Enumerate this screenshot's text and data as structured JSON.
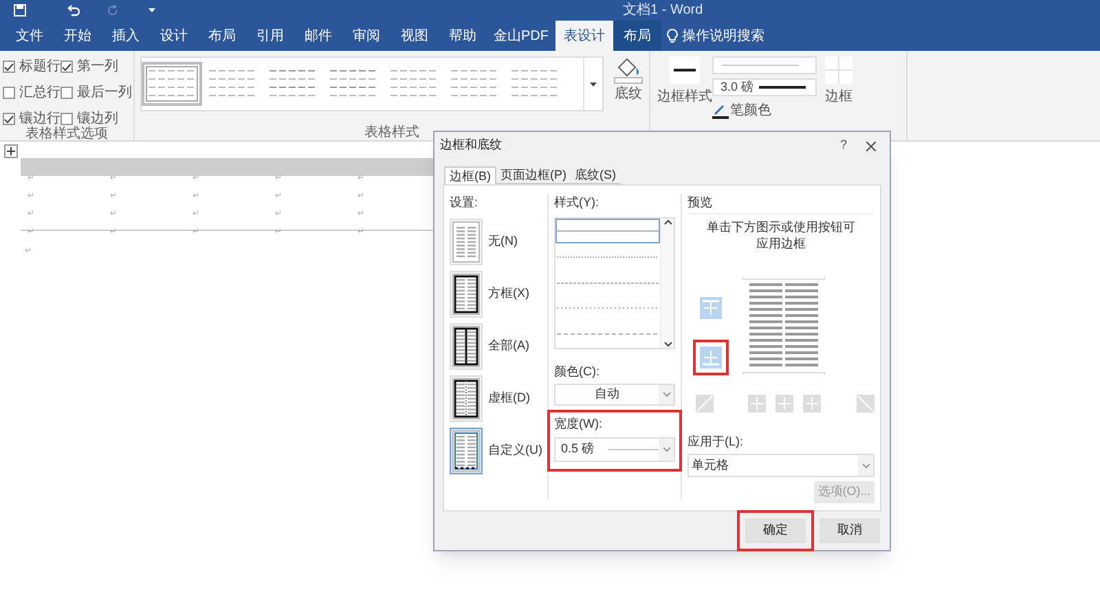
{
  "window": {
    "title": "文档1 - Word"
  },
  "ribbon_tabs": [
    {
      "label": "文件",
      "selected": false,
      "kind": "normal"
    },
    {
      "label": "开始",
      "selected": false,
      "kind": "normal"
    },
    {
      "label": "插入",
      "selected": false,
      "kind": "normal"
    },
    {
      "label": "设计",
      "selected": false,
      "kind": "normal"
    },
    {
      "label": "布局",
      "selected": false,
      "kind": "normal"
    },
    {
      "label": "引用",
      "selected": false,
      "kind": "normal"
    },
    {
      "label": "邮件",
      "selected": false,
      "kind": "normal"
    },
    {
      "label": "审阅",
      "selected": false,
      "kind": "normal"
    },
    {
      "label": "视图",
      "selected": false,
      "kind": "normal"
    },
    {
      "label": "帮助",
      "selected": false,
      "kind": "normal"
    },
    {
      "label": "金山PDF",
      "selected": false,
      "kind": "normal"
    },
    {
      "label": "表设计",
      "selected": true,
      "kind": "contextual"
    },
    {
      "label": "布局",
      "selected": false,
      "kind": "contextual"
    }
  ],
  "search": {
    "label": "操作说明搜索"
  },
  "table_style_options": {
    "group_label": "表格样式选项",
    "items": [
      {
        "label": "标题行",
        "checked": true
      },
      {
        "label": "第一列",
        "checked": true
      },
      {
        "label": "汇总行",
        "checked": false
      },
      {
        "label": "最后一列",
        "checked": false
      },
      {
        "label": "镶边行",
        "checked": true
      },
      {
        "label": "镶边列",
        "checked": false
      }
    ]
  },
  "table_styles": {
    "group_label": "表格样式",
    "styles": [
      {
        "selected": true
      },
      {
        "selected": false
      },
      {
        "selected": false
      },
      {
        "selected": false
      },
      {
        "selected": false
      },
      {
        "selected": false
      },
      {
        "selected": false
      }
    ],
    "shading_label": "底纹"
  },
  "borders_group": {
    "border_styles_label": "边框样式",
    "pen_weight": "3.0 磅",
    "pen_color_label": "笔颜色",
    "borders_label": "边框"
  },
  "document_table": {
    "header_row": {
      "cells": [
        "↵",
        "↵",
        "↵",
        "↵",
        "↵"
      ]
    },
    "rows": [
      {
        "cells": [
          "↵",
          "↵",
          "↵",
          "↵",
          "↵"
        ]
      },
      {
        "cells": [
          "↵",
          "↵",
          "↵",
          "↵",
          "↵"
        ]
      },
      {
        "cells": [
          "↵",
          "↵",
          "↵",
          "↵",
          "↵"
        ]
      }
    ],
    "after_mark": "↵"
  },
  "dialog": {
    "title": "边框和底纹",
    "help": "?",
    "tabs": [
      {
        "label": "边框(B)",
        "selected": true
      },
      {
        "label": "页面边框(P)",
        "selected": false
      },
      {
        "label": "底纹(S)",
        "selected": false
      }
    ],
    "settings_label": "设置:",
    "settings": [
      {
        "label": "无(N)",
        "kind": "none",
        "selected": false
      },
      {
        "label": "方框(X)",
        "kind": "box",
        "selected": false
      },
      {
        "label": "全部(A)",
        "kind": "all",
        "selected": false
      },
      {
        "label": "虚框(D)",
        "kind": "grid",
        "selected": false
      },
      {
        "label": "自定义(U)",
        "kind": "custom",
        "selected": true
      }
    ],
    "style_label": "样式(Y):",
    "styles": [
      {
        "kind": "solid",
        "selected": true
      },
      {
        "kind": "dotted",
        "selected": false
      },
      {
        "kind": "dashdot",
        "selected": false
      },
      {
        "kind": "dots",
        "selected": false
      },
      {
        "kind": "dashed",
        "selected": false
      }
    ],
    "color_label": "颜色(C):",
    "color_value": "自动",
    "width_label": "宽度(W):",
    "width_value": "0.5 磅",
    "width_highlighted": true,
    "preview_label": "预览",
    "preview_hint": "单击下方图示或使用按钮可应用边框",
    "border_buttons": [
      {
        "kind": "top",
        "highlighted": false
      },
      {
        "kind": "bottom",
        "highlighted": true
      }
    ],
    "apply_label": "应用于(L):",
    "apply_value": "单元格",
    "options_button": {
      "label": "选项(O)...",
      "disabled": true
    },
    "ok_button": {
      "label": "确定",
      "highlighted": true
    },
    "cancel_button": {
      "label": "取消"
    }
  }
}
